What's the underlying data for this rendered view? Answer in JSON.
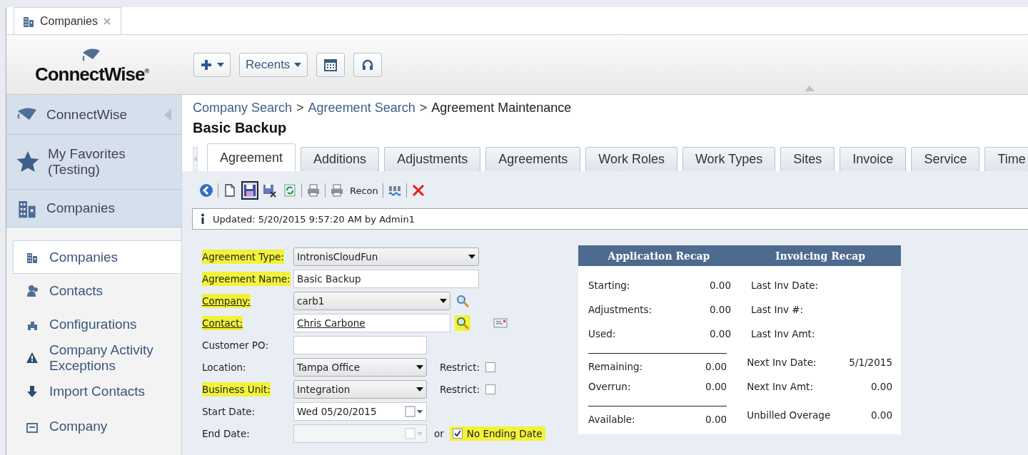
{
  "window_tabs": [
    {
      "label": "Companies",
      "selected": true
    }
  ],
  "logo": {
    "text": "ConnectWise",
    "mark": "®"
  },
  "header_buttons": [
    {
      "kind": "add"
    },
    {
      "kind": "recents",
      "label": "Recents"
    },
    {
      "kind": "calendar"
    },
    {
      "kind": "support"
    }
  ],
  "sidebar": {
    "sections": [
      {
        "label": "ConnectWise"
      },
      {
        "label": "My Favorites (Testing)"
      },
      {
        "label": "Companies"
      }
    ],
    "items": [
      {
        "label": "Companies",
        "selected": true
      },
      {
        "label": "Contacts",
        "selected": false
      },
      {
        "label": "Configurations",
        "selected": false
      },
      {
        "label": "Company Activity Exceptions",
        "selected": false
      },
      {
        "label": "Import Contacts",
        "selected": false
      },
      {
        "label": "Company",
        "selected": false
      }
    ]
  },
  "breadcrumb": {
    "items": [
      {
        "label": "Company Search",
        "link": true
      },
      {
        "label": "Agreement Search",
        "link": true
      },
      {
        "label": "Agreement Maintenance",
        "link": false
      }
    ],
    "separators": [
      ">",
      ">"
    ]
  },
  "title": "Basic Backup",
  "tabs": [
    {
      "label": "Agreement",
      "selected": true
    },
    {
      "label": "Additions",
      "selected": false
    },
    {
      "label": "Adjustments",
      "selected": false
    },
    {
      "label": "Agreements",
      "selected": false
    },
    {
      "label": "Work Roles",
      "selected": false
    },
    {
      "label": "Work Types",
      "selected": false
    },
    {
      "label": "Sites",
      "selected": false
    },
    {
      "label": "Invoice",
      "selected": false
    },
    {
      "label": "Service",
      "selected": false
    },
    {
      "label": "Time",
      "selected": false
    }
  ],
  "toolbar": [
    {
      "kind": "back",
      "selected": false,
      "divider_before": false
    },
    {
      "kind": "new",
      "selected": false,
      "divider_before": true
    },
    {
      "kind": "save",
      "selected": true,
      "divider_before": false
    },
    {
      "kind": "save-close",
      "selected": false,
      "divider_before": false
    },
    {
      "kind": "refresh",
      "selected": false,
      "divider_before": false
    },
    {
      "kind": "print",
      "selected": false,
      "divider_before": true
    },
    {
      "kind": "print",
      "selected": false,
      "divider_before": true
    },
    {
      "kind": "text",
      "label": "Recon",
      "selected": false,
      "divider_before": false
    },
    {
      "kind": "spellcheck",
      "selected": false,
      "divider_before": true
    },
    {
      "kind": "delete",
      "selected": false,
      "divider_before": true
    }
  ],
  "notice": {
    "text": "Updated: 5/20/2015 9:57:20 AM by Admin1"
  },
  "form": [
    {
      "label": "Agreement Type:",
      "kind": "select",
      "value": "IntronisCloudFun",
      "highlighted": true,
      "link": false
    },
    {
      "label": "Agreement Name:",
      "kind": "text",
      "value": "Basic Backup",
      "highlighted": true,
      "link": false
    },
    {
      "label": "Company:",
      "kind": "select",
      "value": "carb1",
      "highlighted": true,
      "link": true,
      "lookup": true,
      "lookup_highlighted": false
    },
    {
      "label": "Contact:",
      "kind": "text",
      "value": "Chris Carbone",
      "value_link": true,
      "highlighted": true,
      "link": true,
      "lookup": true,
      "lookup_highlighted": true,
      "card": true
    },
    {
      "label": "Customer PO:",
      "kind": "text",
      "highlighted": false,
      "link": false
    },
    {
      "label": "Location:",
      "kind": "select",
      "value": "Tampa Office",
      "highlighted": false,
      "link": false,
      "restrict": {
        "label": "Restrict:",
        "checked": false
      }
    },
    {
      "label": "Business Unit:",
      "kind": "select",
      "value": "Integration",
      "highlighted": true,
      "link": false,
      "restrict": {
        "label": "Restrict:",
        "checked": false
      }
    },
    {
      "label": "Start Date:",
      "kind": "date",
      "value": "Wed 05/20/2015",
      "highlighted": false,
      "link": false,
      "disabled": false
    },
    {
      "label": "End Date:",
      "kind": "date",
      "highlighted": false,
      "link": false,
      "disabled": true,
      "alternative": {
        "text": "or",
        "label": "No Ending Date",
        "checked": true,
        "highlighted": true
      }
    }
  ],
  "recap": {
    "titles": [
      "Application Recap",
      "Invoicing Recap"
    ],
    "rows": [
      {
        "label": "Starting:",
        "value": "0.00",
        "label_2": "Last Inv Date:",
        "rule_above": false
      },
      {
        "label": "Adjustments:",
        "value": "0.00",
        "label_2": "Last Inv #:",
        "rule_above": false
      },
      {
        "label": "Used:",
        "value": "0.00",
        "label_2": "Last Inv Amt:",
        "rule_above": false
      },
      {
        "label": "Remaining:",
        "value": "0.00",
        "label_2": "Next Inv Date:",
        "value_2": "5/1/2015",
        "rule_above": true
      },
      {
        "label": "Overrun:",
        "value": "0.00",
        "label_2": "Next Inv Amt:",
        "value_2": "0.00",
        "rule_above": false
      },
      {
        "label": "Available:",
        "value": "0.00",
        "label_2": "Unbilled Overage",
        "value_2": "0.00",
        "rule_above": true
      }
    ]
  }
}
